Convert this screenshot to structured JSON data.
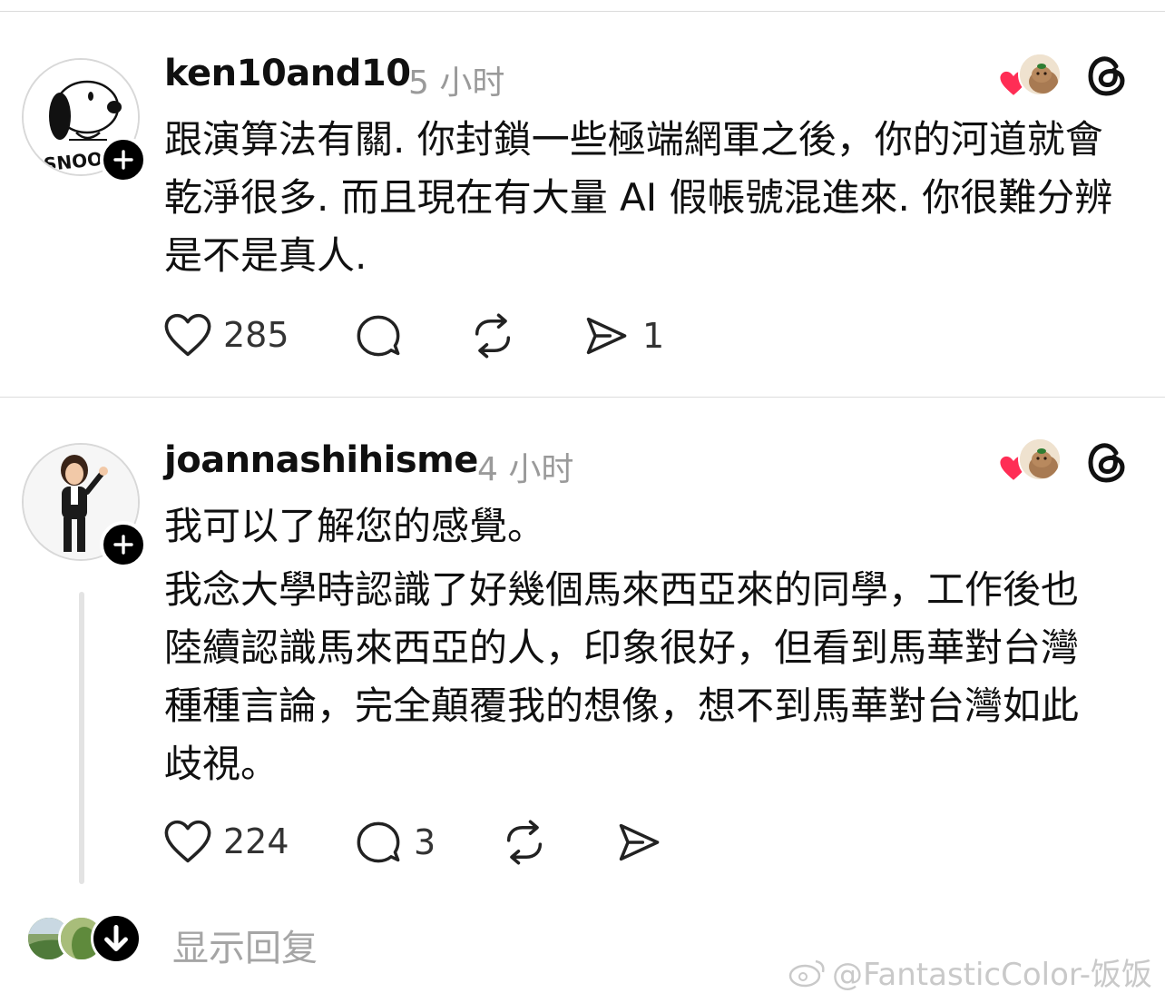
{
  "posts": [
    {
      "username": "ken10and10",
      "time": "5 小时",
      "avatar_text": "SNOO",
      "paragraphs": [
        "跟演算法有關. 你封鎖一些極端網軍之後，你的河道就會乾淨很多. 而且現在有大量 AI 假帳號混進來. 你很難分辨是不是真人."
      ],
      "actions": {
        "likes": "285",
        "replies": "",
        "reposts": "",
        "shares": "1"
      }
    },
    {
      "username": "joannashihisme",
      "time": "4 小时",
      "paragraphs": [
        "我可以了解您的感覺。",
        "我念大學時認識了好幾個馬來西亞來的同學，工作後也陸續認識馬來西亞的人，印象很好，但看到馬華對台灣種種言論，完全顛覆我的想像，想不到馬華對台灣如此歧視。"
      ],
      "actions": {
        "likes": "224",
        "replies": "3",
        "reposts": "",
        "shares": ""
      }
    }
  ],
  "footer": {
    "show_replies_label": "显示回复",
    "watermark": "@FantasticColor-饭饭"
  },
  "icons": {
    "like": "heart-outline-icon",
    "reply": "speech-bubble-icon",
    "repost": "repost-icon",
    "share": "send-icon",
    "threads": "threads-logo-icon",
    "follow": "plus-icon",
    "liked_by": "red-heart-icon",
    "expand": "arrow-down-icon"
  },
  "colors": {
    "text": "#101010",
    "muted": "#9a9a9a",
    "heart": "#ff2d55",
    "divider": "#dcdcdc"
  }
}
